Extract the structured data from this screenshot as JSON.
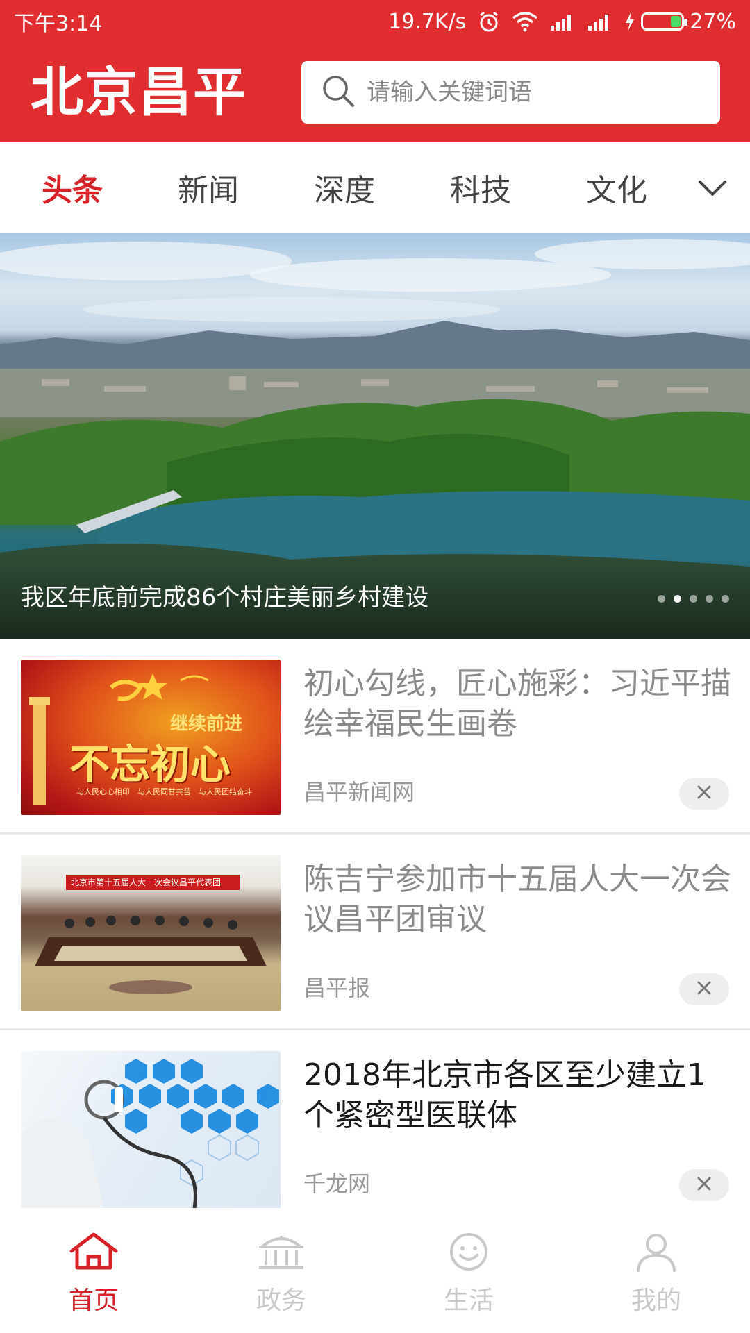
{
  "status_bar": {
    "time": "下午3:14",
    "network_speed": "19.7K/s",
    "battery": "27%",
    "battery_level": 0.27,
    "icons": [
      "alarm-icon",
      "wifi-icon",
      "signal-icon",
      "signal-icon",
      "charging-icon",
      "battery-icon"
    ]
  },
  "header": {
    "brand": "北京昌平",
    "search_placeholder": "请输入关键词语"
  },
  "tabs": [
    {
      "label": "头条",
      "active": true
    },
    {
      "label": "新闻",
      "active": false
    },
    {
      "label": "深度",
      "active": false
    },
    {
      "label": "科技",
      "active": false
    },
    {
      "label": "文化",
      "active": false
    }
  ],
  "banner": {
    "caption": "我区年底前完成86个村庄美丽乡村建设",
    "slide_count": 5,
    "active_slide": 2
  },
  "news": [
    {
      "title": "初心勾线，匠心施彩：习近平描绘幸福民生画卷",
      "source": "昌平新闻网",
      "read": true,
      "thumb_text_main": "不忘初心",
      "thumb_text_sub": "继续前进",
      "thumb_text_small": "与人民心心相印　与人民同甘共苦　与人民团结奋斗"
    },
    {
      "title": "陈吉宁参加市十五届人大一次会议昌平团审议",
      "source": "昌平报",
      "read": true,
      "thumb_text_main": "北京市第十五届人大一次会议昌平代表团"
    },
    {
      "title": "2018年北京市各区至少建立1个紧密型医联体",
      "source": "千龙网",
      "read": false
    }
  ],
  "bottom_nav": [
    {
      "label": "首页",
      "icon": "home-icon",
      "active": true
    },
    {
      "label": "政务",
      "icon": "government-icon",
      "active": false
    },
    {
      "label": "生活",
      "icon": "smile-icon",
      "active": false
    },
    {
      "label": "我的",
      "icon": "user-icon",
      "active": false
    }
  ],
  "colors": {
    "brand_red": "#e02e30",
    "active_red": "#d8222a"
  }
}
